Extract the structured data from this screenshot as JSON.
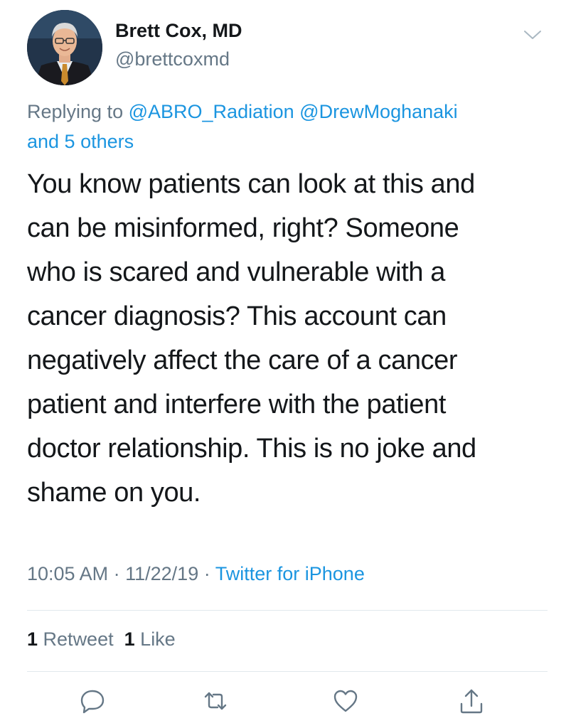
{
  "author": {
    "display_name": "Brett Cox, MD",
    "handle": "@brettcoxmd",
    "avatar_icon": "profile-photo"
  },
  "menu_icon": "chevron-down-icon",
  "replying": {
    "prefix": "Replying to",
    "mentions": [
      "@ABRO_Radiation",
      "@DrewMoghanaki"
    ],
    "others": "and 5 others"
  },
  "tweet": {
    "text": "You know patients can look at this and\ncan be misinformed, right?  Someone\nwho is scared and vulnerable with a\ncancer diagnosis?  This account can\nnegatively affect the care of a cancer\npatient and interfere with the patient\ndoctor relationship.  This is no joke and\nshame on you."
  },
  "meta": {
    "time": "10:05 AM",
    "separator": "·",
    "date": "11/22/19",
    "source": "Twitter for iPhone"
  },
  "stats": {
    "retweets_count": "1",
    "retweets_label": "Retweet",
    "likes_count": "1",
    "likes_label": "Like"
  },
  "actions": [
    {
      "name": "reply",
      "icon": "reply-icon"
    },
    {
      "name": "retweet",
      "icon": "retweet-icon"
    },
    {
      "name": "like",
      "icon": "heart-icon"
    },
    {
      "name": "share",
      "icon": "share-icon"
    }
  ],
  "colors": {
    "link": "#1b95e0",
    "secondary_text": "#657786",
    "primary_text": "#14171a",
    "divider": "#e1e8ed"
  }
}
